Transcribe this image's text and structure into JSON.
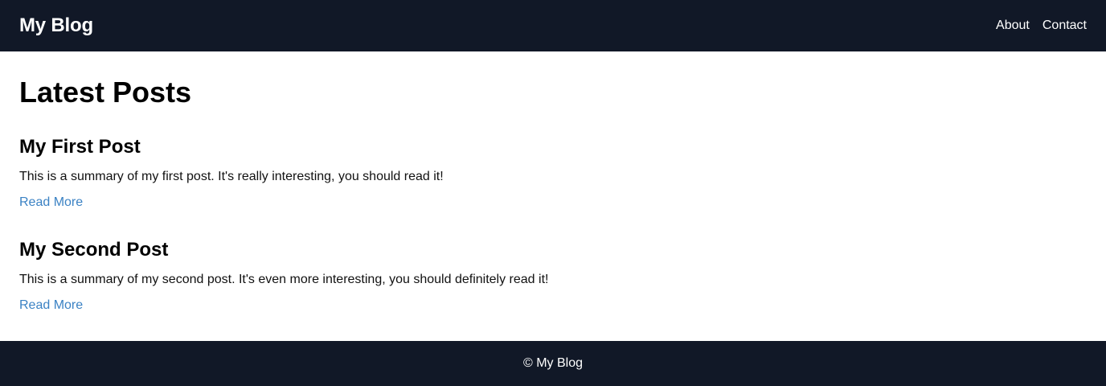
{
  "header": {
    "brand": "My Blog",
    "nav": [
      "About",
      "Contact"
    ]
  },
  "main": {
    "title": "Latest Posts",
    "posts": [
      {
        "title": "My First Post",
        "summary": "This is a summary of my first post. It's really interesting, you should read it!",
        "link_label": "Read More"
      },
      {
        "title": "My Second Post",
        "summary": "This is a summary of my second post. It's even more interesting, you should definitely read it!",
        "link_label": "Read More"
      }
    ]
  },
  "footer": {
    "text": "© My Blog"
  },
  "colors": {
    "header_bg": "#111827",
    "footer_bg": "#111827",
    "link": "#3b82c4",
    "text": "#111111",
    "background": "#ffffff"
  }
}
